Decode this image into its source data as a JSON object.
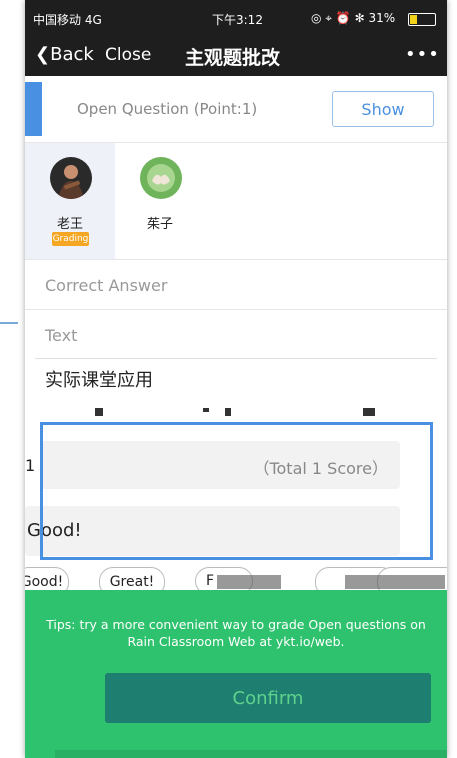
{
  "status_bar": {
    "carrier": "中国移动 4G",
    "time": "下午3:12",
    "icons": "◎ ⌖ ⏰ ✻ 31%",
    "battery_level": 0.31,
    "battery_color": "#f2d21a"
  },
  "nav": {
    "back": "Back",
    "close": "Close",
    "title": "主观题批改",
    "more": "•••"
  },
  "question": {
    "label": "Open Question (Point:1)",
    "show": "Show"
  },
  "students": [
    {
      "name": "老王",
      "badge": "Grading",
      "selected": true
    },
    {
      "name": "茱子",
      "badge": "",
      "selected": false
    }
  ],
  "answer": {
    "correct_header": "Correct Answer",
    "text_header": "Text",
    "content": "实际课堂应用"
  },
  "score": {
    "number": "1",
    "total": "（Total 1 Score）",
    "comment": "Good!"
  },
  "chips": [
    "Good!",
    "Great!",
    "F"
  ],
  "tips": {
    "line1": "Tips: try a more convenient way to grade Open questions on",
    "line2": "Rain Classroom Web at ykt.io/web."
  },
  "confirm": "Confirm",
  "colors": {
    "accent": "#4a90e2",
    "badge": "#f5a623",
    "green": "#2fc26e",
    "confirm_bg": "#1e7e6f"
  }
}
